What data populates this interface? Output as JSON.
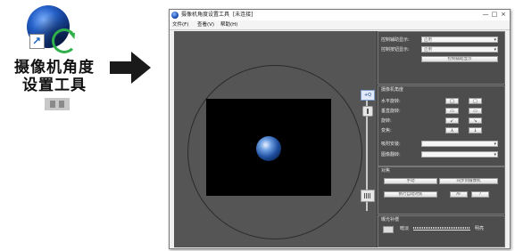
{
  "desktop_icon": {
    "label_line1": "摄像机角度",
    "label_line2": "设置工具"
  },
  "window": {
    "title": "摄像机角度设置工具",
    "title_suffix": "[未连接]",
    "controls": [
      "—",
      "□",
      "×"
    ]
  },
  "menu": [
    {
      "label": "文件(F)"
    },
    {
      "label": "查看(V)"
    },
    {
      "label": "帮助(H)"
    }
  ],
  "viewport": {
    "zoom_in_label": "+Q"
  },
  "panel": {
    "display": {
      "row1_label": "控制辅助显示:",
      "row1_value": "启用",
      "row2_label": "控制按钮显示:",
      "row2_value": "启用",
      "button_label": "控制辅助显示"
    },
    "camera_angle": {
      "title": "摄像机角度",
      "rows": [
        {
          "label": "水平旋转:"
        },
        {
          "label": "垂直旋转:"
        },
        {
          "label": "旋转:"
        },
        {
          "label": "变焦:"
        }
      ],
      "buttons": [
        {
          "icon": "□",
          "name": "pan-left"
        },
        {
          "icon": "□",
          "name": "pan-right"
        },
        {
          "icon": "▭",
          "name": "tilt-down"
        },
        {
          "icon": "▭",
          "name": "tilt-up"
        },
        {
          "icon": "↙",
          "name": "rotate-left"
        },
        {
          "icon": "↘",
          "name": "rotate-right"
        },
        {
          "icon": "⅄",
          "name": "zoom-out"
        },
        {
          "icon": "↓",
          "name": "zoom-in"
        }
      ],
      "mount_label": "吸附安装:",
      "flip_label": "图像翻转:"
    },
    "focus": {
      "title": "对焦",
      "button1": "手动",
      "button2": "同步到摄像机",
      "button3": "执行自动对焦",
      "icon_button1": "AF",
      "icon_button2": "?"
    },
    "exposure": {
      "title": "曝光补偿",
      "dark_label": "暗淡",
      "bright_label": "明亮"
    }
  }
}
